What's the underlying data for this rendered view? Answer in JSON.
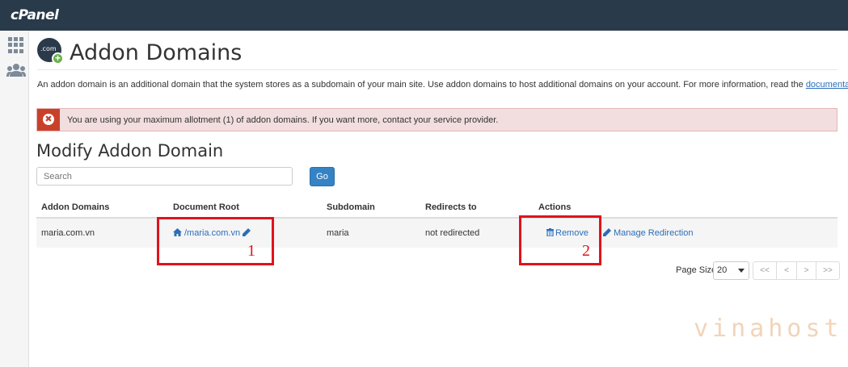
{
  "app": {
    "logo": "cPanel"
  },
  "page": {
    "title": "Addon Domains",
    "header_icon_text": ".com",
    "intro_text": "An addon domain is an additional domain that the system stores as a subdomain of your main site. Use addon domains to host additional domains on your account. For more information, read the ",
    "intro_link": "documentation",
    "intro_end": "."
  },
  "alert": {
    "text": "You are using your maximum allotment (1) of addon domains. If you want more, contact your service provider."
  },
  "section": {
    "title": "Modify Addon Domain"
  },
  "search": {
    "placeholder": "Search",
    "go_label": "Go"
  },
  "table": {
    "columns": [
      "Addon Domains",
      "Document Root",
      "Subdomain",
      "Redirects to",
      "Actions"
    ],
    "rows": [
      {
        "domain": "maria.com.vn",
        "document_root": "/maria.com.vn",
        "subdomain": "maria",
        "redirects_to": "not redirected",
        "remove_label": "Remove",
        "manage_label": "Manage Redirection"
      }
    ]
  },
  "annotations": [
    "1",
    "2"
  ],
  "pager": {
    "label": "Page Size",
    "page_size": "20",
    "buttons": [
      "<<",
      "<",
      ">",
      ">>"
    ]
  },
  "watermark": {
    "text": "vinahost.",
    "mark": "✓"
  },
  "colors": {
    "topbar": "#293a4a",
    "link": "#2a6ebb",
    "alert_bg": "#f2dede",
    "alert_icon": "#c9402a",
    "button": "#3583c5",
    "annotation": "#e0131c"
  },
  "icons": [
    "grid-icon",
    "users-icon",
    "addon-domain-icon",
    "close-circle-icon",
    "home-icon",
    "pencil-icon",
    "trash-icon",
    "caret-down-icon"
  ]
}
